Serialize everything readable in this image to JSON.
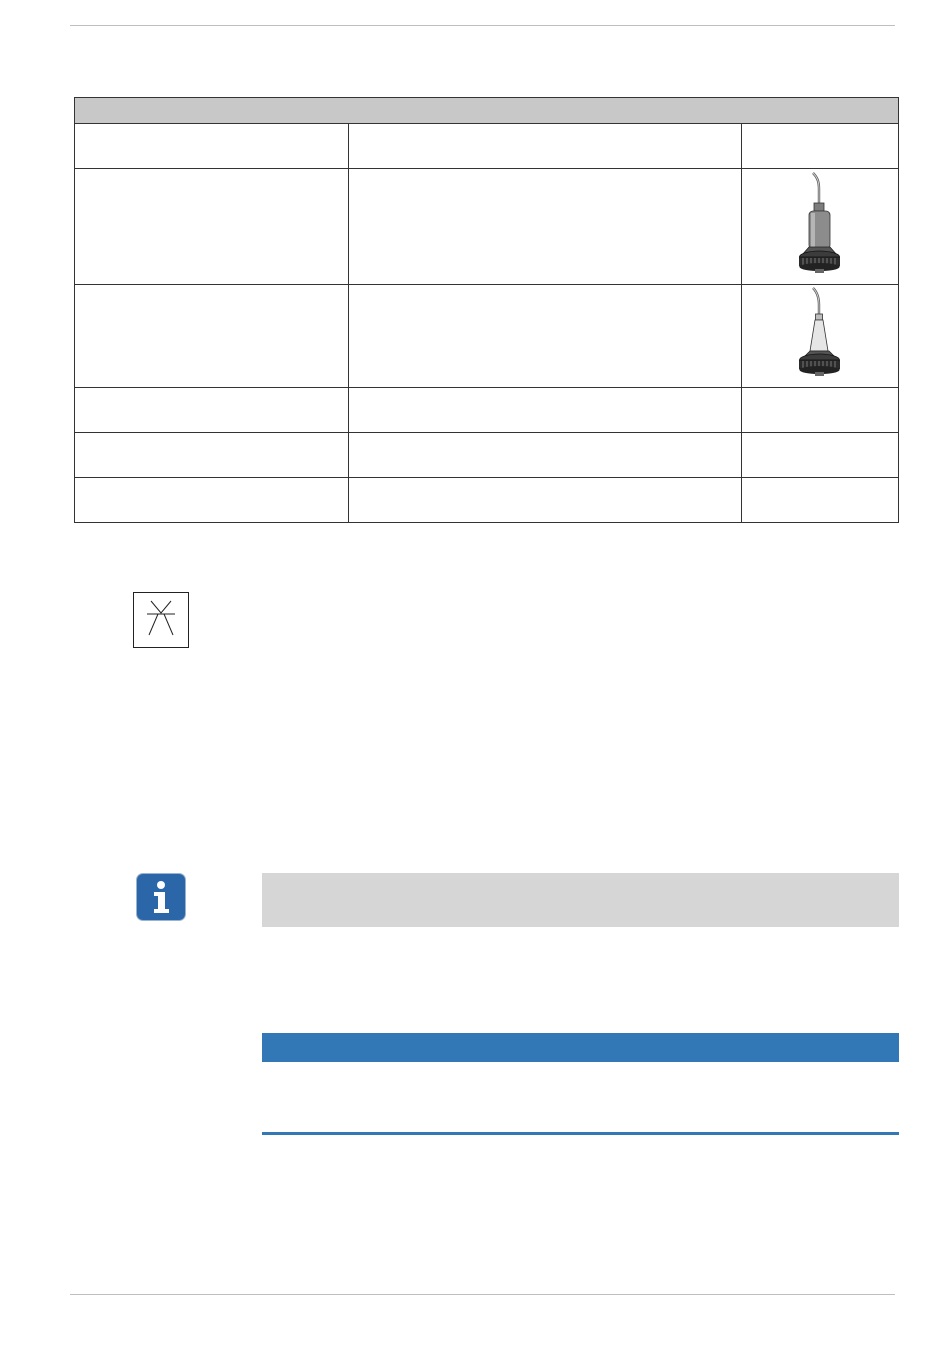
{
  "colors": {
    "table_header_bg": "#c8c8c8",
    "info_box_bg": "#d6d6d6",
    "notice_accent": "#3277b6",
    "info_icon_bg": "#2b67a8"
  },
  "icons": {
    "symbol": "spray-symbol-icon",
    "info": "info-icon",
    "row1_image": "scaler-tip-gray-handpiece-icon",
    "row2_image": "scaler-tip-light-handpiece-icon"
  },
  "table": {
    "header": "",
    "rows": [
      [
        "",
        "",
        ""
      ],
      [
        "",
        "",
        ""
      ],
      [
        "",
        "",
        ""
      ],
      [
        "",
        "",
        ""
      ],
      [
        "",
        "",
        ""
      ],
      [
        "",
        "",
        ""
      ]
    ]
  },
  "info_box": {
    "text": ""
  },
  "notice": {
    "title": "",
    "text": ""
  }
}
